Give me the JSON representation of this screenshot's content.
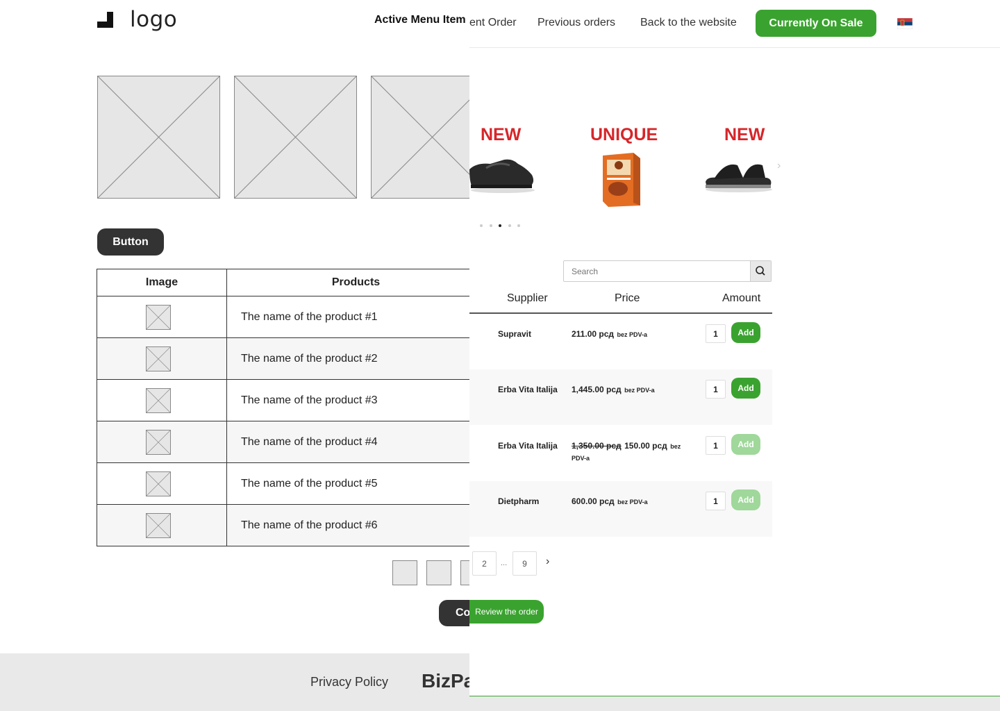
{
  "wireframe": {
    "logo_text": "logo",
    "active_menu": "Active Menu Item",
    "button_label": "Button",
    "table": {
      "headers": [
        "Image",
        "Products"
      ],
      "rows": [
        "The name of the product #1",
        "The name of the product #2",
        "The name of the product #3",
        "The name of the product #4",
        "The name of the product #5",
        "The name of the product #6"
      ]
    },
    "confirm_label_partial": "Co",
    "footer": {
      "privacy": "Privacy Policy",
      "brand_partial": "BizPa"
    }
  },
  "nav": {
    "current_order_partial": "ent Order",
    "previous_orders": "Previous orders",
    "back_to_website": "Back to the website",
    "on_sale": "Currently On Sale",
    "flag": "serbia-flag"
  },
  "carousel": {
    "slides": [
      {
        "badge": "NEW",
        "item": "clog-shoe"
      },
      {
        "badge": "UNIQUE",
        "item": "product-box"
      },
      {
        "badge": "NEW",
        "item": "sandal"
      }
    ],
    "dots": 5,
    "active_dot": 3
  },
  "search": {
    "placeholder": "Search"
  },
  "orders_table": {
    "headers": {
      "supplier": "Supplier",
      "price": "Price",
      "amount": "Amount"
    },
    "rows": [
      {
        "supplier": "Supravit",
        "old_price": "",
        "price": "211.00 рсд",
        "vat": "bez PDV-a",
        "qty": "1",
        "add": "Add",
        "enabled": true
      },
      {
        "supplier": "Erba Vita Italija",
        "old_price": "",
        "price": "1,445.00 рсд",
        "vat": "bez PDV-a",
        "qty": "1",
        "add": "Add",
        "enabled": true
      },
      {
        "supplier": "Erba Vita Italija",
        "old_price": "1,350.00 рсд",
        "price": "150.00 рсд",
        "vat": "bez PDV-a",
        "qty": "1",
        "add": "Add",
        "enabled": false
      },
      {
        "supplier": "Dietpharm",
        "old_price": "",
        "price": "600.00 рсд",
        "vat": "bez PDV-a",
        "qty": "1",
        "add": "Add",
        "enabled": false
      }
    ]
  },
  "pagination": {
    "pages": [
      "2",
      "9"
    ],
    "ellipsis": "...",
    "next": "›"
  },
  "review_button": "Review the order",
  "colors": {
    "green": "#3aa32f",
    "green_disabled": "#9fd89a",
    "red_badge": "#d6262a",
    "dark": "#333333"
  }
}
